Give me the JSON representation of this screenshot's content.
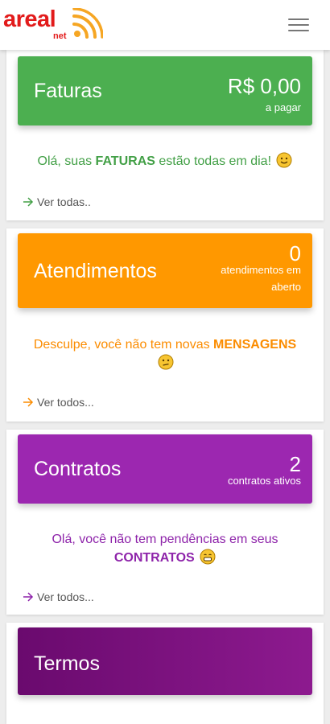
{
  "brand": {
    "word": "areal",
    "sub": "net",
    "color": "#e21b1b",
    "accent": "#f6a623"
  },
  "menu": {
    "icon": "hamburger-menu-icon"
  },
  "cards": [
    {
      "id": "faturas",
      "title": "Faturas",
      "value": "R$ 0,00",
      "sub": "a pagar",
      "message_pre": "Olá, suas ",
      "message_bold": "FATURAS",
      "message_post": " estão todas em dia!",
      "emoji": "smiling-face-icon",
      "link": "Ver todas..",
      "color": "#4caf50",
      "text_color": "#43a047"
    },
    {
      "id": "atendimentos",
      "title": "Atendimentos",
      "value": "0",
      "sub_line1": "atendimentos em",
      "sub_line2": "aberto",
      "message_pre": "Desculpe, você não tem novas ",
      "message_bold": "MENSAGENS",
      "emoji": "confused-face-icon",
      "link": "Ver todos...",
      "color": "#ff9800",
      "text_color": "#fb8c00"
    },
    {
      "id": "contratos",
      "title": "Contratos",
      "value": "2",
      "sub": "contratos ativos",
      "message_pre": "Olá, você não tem pendências em seus",
      "message_bold": "CONTRATOS",
      "emoji": "grinning-face-icon",
      "link": "Ver todos...",
      "color": "#9c27b0",
      "text_color": "#8e24aa"
    },
    {
      "id": "termos",
      "title": "Termos",
      "color_start": "#6a0a6e",
      "color_end": "#8d1a8f"
    }
  ]
}
